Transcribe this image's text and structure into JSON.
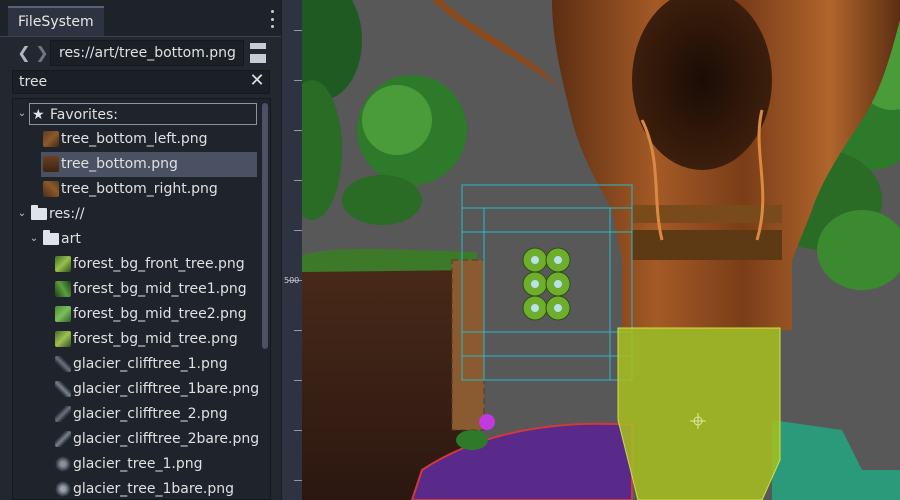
{
  "filesystem": {
    "tab_label": "FileSystem",
    "path": "res://art/tree_bottom.png",
    "search": "tree",
    "favorites_label": "Favorites:",
    "favorites": [
      {
        "name": "tree_bottom_left.png",
        "selected": false
      },
      {
        "name": "tree_bottom.png",
        "selected": true
      },
      {
        "name": "tree_bottom_right.png",
        "selected": false
      }
    ],
    "root_label": "res://",
    "folder_label": "art",
    "files": [
      "forest_bg_front_tree.png",
      "forest_bg_mid_tree1.png",
      "forest_bg_mid_tree2.png",
      "forest_bg_mid_tree.png",
      "glacier_clifftree_1.png",
      "glacier_clifftree_1bare.png",
      "glacier_clifftree_2.png",
      "glacier_clifftree_2bare.png",
      "glacier_tree_1.png",
      "glacier_tree_1bare.png"
    ]
  },
  "viewport": {
    "ruler_label": "500"
  },
  "colors": {
    "accent": "#4a5163",
    "guide": "#2bb8c9",
    "selection_fill": "#a8bf1e"
  }
}
